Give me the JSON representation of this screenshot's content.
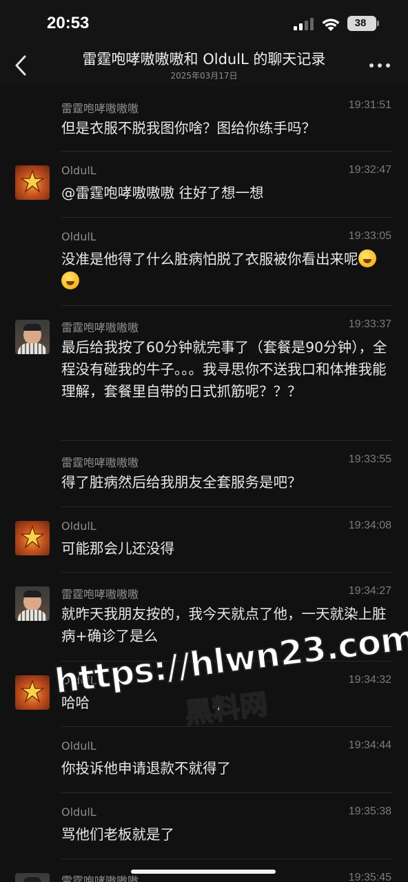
{
  "status_bar": {
    "time": "20:53",
    "battery": "38"
  },
  "header": {
    "title": "雷霆咆哮嗷嗷嗷和 OldulL 的聊天记录",
    "date": "2025年03月17日"
  },
  "messages": [
    {
      "sender": "雷霆咆哮嗷嗷嗷",
      "time": "19:31:51",
      "text": "但是衣服不脱我图你啥？图给你练手吗？",
      "avatar": "none"
    },
    {
      "sender": "OldulL",
      "time": "19:32:47",
      "text": "@雷霆咆哮嗷嗷嗷 往好了想一想",
      "avatar": "star-badge"
    },
    {
      "sender": "OldulL",
      "time": "19:33:05",
      "text": "没准是他得了什么脏病怕脱了衣服被你看出来呢",
      "avatar": "none",
      "emoji": "yawning-face"
    },
    {
      "sender": "雷霆咆哮嗷嗷嗷",
      "time": "19:33:37",
      "text": "最后给我按了60分钟就完事了（套餐是90分钟），全程没有碰我的牛子。。。我寻思你不送我口和体推我能理解，套餐里自带的日式抓筋呢？？？",
      "avatar": "man-photo"
    },
    {
      "sender": "雷霆咆哮嗷嗷嗷",
      "time": "19:33:55",
      "text": "得了脏病然后给我朋友全套服务是吧？",
      "avatar": "none"
    },
    {
      "sender": "OldulL",
      "time": "19:34:08",
      "text": "可能那会儿还没得",
      "avatar": "star-badge"
    },
    {
      "sender": "雷霆咆哮嗷嗷嗷",
      "time": "19:34:27",
      "text": "就昨天我朋友按的，我今天就点了他，一天就染上脏病+确诊了是么",
      "avatar": "man-photo"
    },
    {
      "sender": "OldulL",
      "time": "19:34:32",
      "text": "哈哈",
      "avatar": "star-badge"
    },
    {
      "sender": "OldulL",
      "time": "19:34:44",
      "text": "你投诉他申请退款不就得了",
      "avatar": "none"
    },
    {
      "sender": "OldulL",
      "time": "19:35:38",
      "text": "骂他们老板就是了",
      "avatar": "none"
    },
    {
      "sender": "雷霆咆哮嗷嗷嗷",
      "time": "19:35:45",
      "text": "",
      "avatar": "man-photo"
    }
  ],
  "watermark": {
    "url": "https://hlwn23.com",
    "name": "黑料网"
  },
  "colors": {
    "background": "#111111",
    "text": "#e8e8e8",
    "meta": "#8d8d8d"
  }
}
